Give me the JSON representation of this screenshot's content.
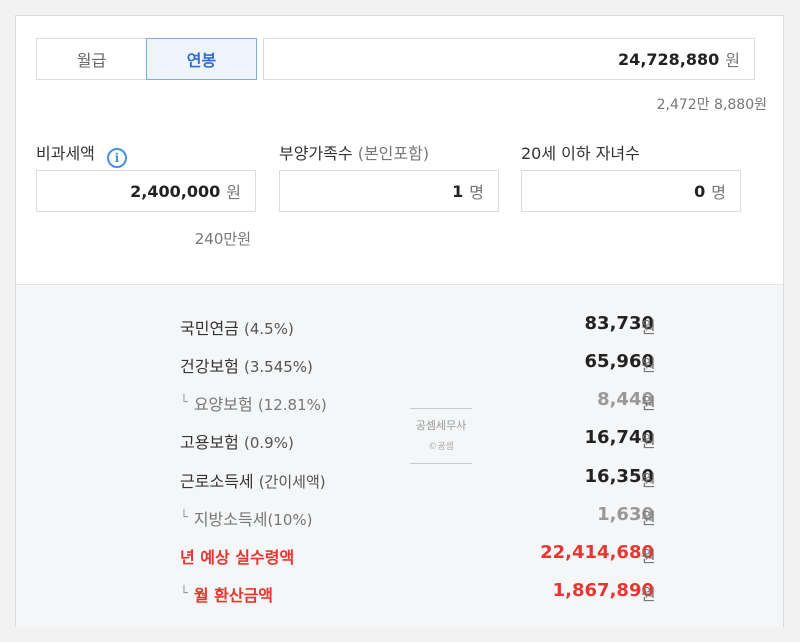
{
  "tabs": [
    {
      "label": "월급",
      "active": false
    },
    {
      "label": "연봉",
      "active": true
    }
  ],
  "salary": {
    "value": "24,728,880",
    "unit": "원",
    "korean": "2,472만 8,880원"
  },
  "fields": {
    "nontax": {
      "label": "비과세액",
      "value": "2,400,000",
      "unit": "원",
      "korean": "240만원",
      "icon": "info-icon"
    },
    "dependents": {
      "label": "부양가족수",
      "label_note": "(본인포함)",
      "value": "1",
      "unit": "명"
    },
    "children": {
      "label": "20세 이하 자녀수",
      "value": "0",
      "unit": "명"
    }
  },
  "results": [
    {
      "label": "국민연금",
      "note": "(4.5%)",
      "value": "83,730",
      "unit": "원"
    },
    {
      "label": "건강보험",
      "note": "(3.545%)",
      "value": "65,960",
      "unit": "원"
    },
    {
      "prefix": "└",
      "label": "요양보험",
      "note": "(12.81%)",
      "value": "8,440",
      "unit": "원"
    },
    {
      "label": "고용보험",
      "note": "(0.9%)",
      "value": "16,740",
      "unit": "원"
    },
    {
      "label": "근로소득세",
      "note": "(간이세액)",
      "value": "16,350",
      "unit": "원"
    },
    {
      "prefix": "└",
      "label": "지방소득세",
      "note": "(10%)",
      "value": "1,630",
      "unit": "원"
    },
    {
      "label": "년 예상 실수령액",
      "note": "",
      "value": "22,414,680",
      "unit": "원"
    },
    {
      "prefix": "└",
      "label": "월 환산금액",
      "note": "",
      "value": "1,867,890",
      "unit": "원"
    }
  ],
  "stamp": {
    "line1": "공셈세무사",
    "line2": "©공셈"
  },
  "colors": {
    "accent": "#2f6fd0",
    "highlight": "#e8352f",
    "info": "#4a8fe0"
  }
}
